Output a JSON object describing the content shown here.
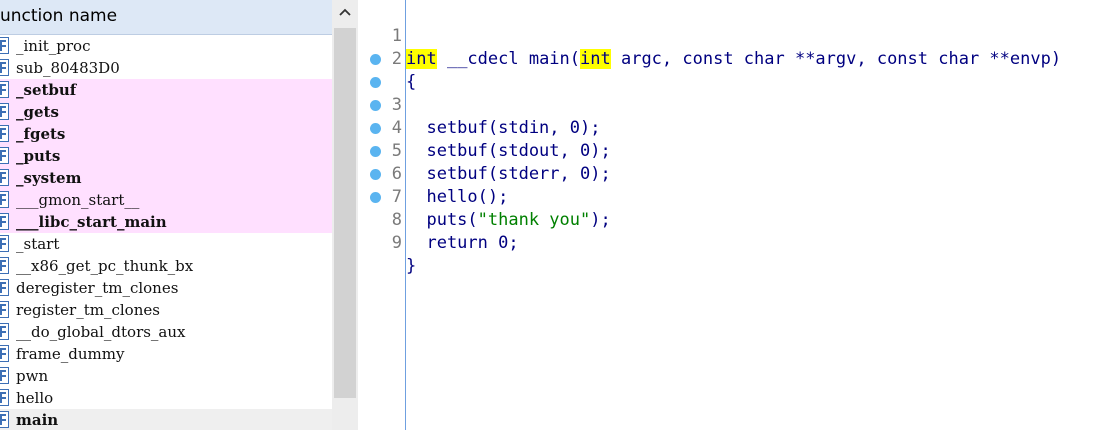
{
  "functions_panel": {
    "header": "unction name",
    "items": [
      {
        "name": "_init_proc",
        "kind": "normal"
      },
      {
        "name": "sub_80483D0",
        "kind": "normal"
      },
      {
        "name": "_setbuf",
        "kind": "library"
      },
      {
        "name": "_gets",
        "kind": "library"
      },
      {
        "name": "_fgets",
        "kind": "library"
      },
      {
        "name": "_puts",
        "kind": "library"
      },
      {
        "name": "_system",
        "kind": "library"
      },
      {
        "name": "___gmon_start__",
        "kind": "library-normal"
      },
      {
        "name": "___libc_start_main",
        "kind": "library"
      },
      {
        "name": "_start",
        "kind": "normal"
      },
      {
        "name": "__x86_get_pc_thunk_bx",
        "kind": "normal"
      },
      {
        "name": "deregister_tm_clones",
        "kind": "normal"
      },
      {
        "name": "register_tm_clones",
        "kind": "normal"
      },
      {
        "name": "__do_global_dtors_aux",
        "kind": "normal"
      },
      {
        "name": "frame_dummy",
        "kind": "normal"
      },
      {
        "name": "pwn",
        "kind": "normal"
      },
      {
        "name": "hello",
        "kind": "normal"
      },
      {
        "name": "main",
        "kind": "selected"
      }
    ],
    "icon": "function-icon",
    "scroll_up_icon": "chevron-up-icon"
  },
  "code": {
    "lines": [
      {
        "num": "1",
        "breakpoint": false
      },
      {
        "num": "2",
        "breakpoint": false
      },
      {
        "num": "3",
        "breakpoint": true
      },
      {
        "num": "4",
        "breakpoint": true
      },
      {
        "num": "5",
        "breakpoint": true
      },
      {
        "num": "6",
        "breakpoint": true
      },
      {
        "num": "7",
        "breakpoint": true
      },
      {
        "num": "8",
        "breakpoint": true
      },
      {
        "num": "9",
        "breakpoint": true
      }
    ],
    "l1": {
      "kw1": "int",
      "mid": " __cdecl main(",
      "kw2": "int",
      "rest": " argc, const char **argv, const char **envp)"
    },
    "l2": "{",
    "l3": "  setbuf(stdin, 0);",
    "l4": "  setbuf(stdout, 0);",
    "l5": "  setbuf(stderr, 0);",
    "l6": "  hello();",
    "l7": {
      "pre": "  puts(",
      "str": "\"thank you\"",
      "post": ");"
    },
    "l8": "  return 0;",
    "l9": "}",
    "colors": {
      "text": "#000080",
      "string": "#008000",
      "highlight": "#ffff00",
      "breakpoint": "#5ab4f0",
      "library_row": "#ffe0ff"
    }
  }
}
